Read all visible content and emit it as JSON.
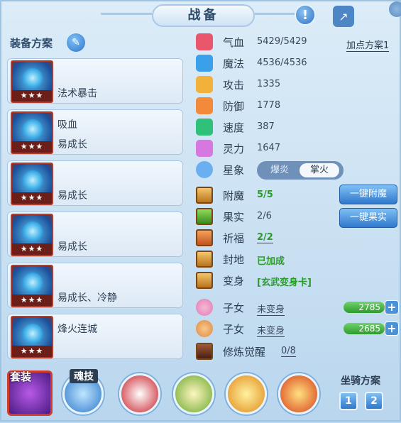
{
  "header": {
    "title": "战备"
  },
  "scheme": {
    "label": "装备方案"
  },
  "equipment": [
    {
      "line1": "法术暴击",
      "line2": "",
      "stars": "★★★"
    },
    {
      "line1": "吸血",
      "line2": "易成长",
      "stars": "★★★"
    },
    {
      "line1": "易成长",
      "line2": "",
      "stars": "★★★"
    },
    {
      "line1": "易成长",
      "line2": "",
      "stars": "★★★"
    },
    {
      "line1": "易成长、冷静",
      "line2": "",
      "stars": "★★★"
    },
    {
      "line1": "烽火连城",
      "line2": "",
      "stars": "★★★"
    }
  ],
  "stats": {
    "hp": {
      "name": "气血",
      "value": "5429/5429"
    },
    "mp": {
      "name": "魔法",
      "value": "4536/4536"
    },
    "atk": {
      "name": "攻击",
      "value": "1335"
    },
    "def": {
      "name": "防御",
      "value": "1778"
    },
    "spd": {
      "name": "速度",
      "value": "387"
    },
    "spi": {
      "name": "灵力",
      "value": "1647"
    },
    "add_plan": "加点方案1"
  },
  "star": {
    "name": "星象",
    "opt_a": "爆炎",
    "opt_b": "掌火"
  },
  "enchant": {
    "name": "附魔",
    "value": "5/5"
  },
  "fruit": {
    "name": "果实",
    "value": "2/6"
  },
  "blessing": {
    "name": "祈福",
    "value": "2/2"
  },
  "seal": {
    "name": "封地",
    "value": "已加成"
  },
  "transform": {
    "name": "变身",
    "value": "[玄武变身卡]"
  },
  "child1": {
    "name": "子女",
    "value": "未变身",
    "points": "2785"
  },
  "child2": {
    "name": "子女",
    "value": "未变身",
    "points": "2685"
  },
  "cultivation": {
    "name": "修炼觉醒",
    "value": "0/8"
  },
  "buttons": {
    "auto_enchant": "一键附魔",
    "auto_fruit": "一键果实",
    "plus": "+"
  },
  "bottom": {
    "suit": "套装",
    "soul": "魂技",
    "mount_label": "坐骑方案",
    "mount1": "1",
    "mount2": "2"
  },
  "icons": {
    "info": "!",
    "share": "↗",
    "edit": "✎"
  }
}
